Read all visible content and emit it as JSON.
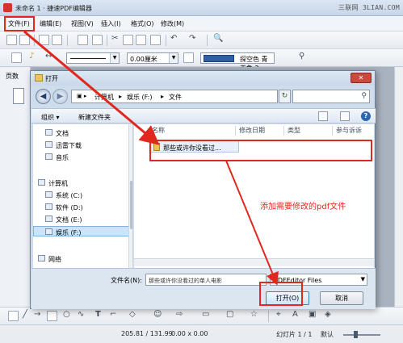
{
  "window": {
    "title": "未命名 1 · 捷速PDF编辑器",
    "watermark": "三联网 3LIAN.COM"
  },
  "menu": {
    "items": [
      "文件(F)",
      "编辑(E)",
      "视图(V)",
      "插入(I)",
      "格式(O)",
      "修改(M)"
    ]
  },
  "toolbar": {
    "line_width_value": "0.00厘米",
    "color_value": "探空色 青天色 2"
  },
  "sidebar": {
    "label": "页数"
  },
  "dialog": {
    "title": "打开",
    "close_label": "✕",
    "address": {
      "crumbs": [
        "计算机",
        "娱乐 (F:)",
        "文件"
      ]
    },
    "commands": {
      "organize": "组织 ▾",
      "new_folder": "新建文件夹"
    },
    "nav_items": [
      {
        "label": "文档",
        "icon": "document-icon"
      },
      {
        "label": "迅雷下载",
        "icon": "download-icon"
      },
      {
        "label": "音乐",
        "icon": "music-icon"
      },
      {
        "label": "计算机",
        "icon": "computer-icon"
      },
      {
        "label": "系统 (C:)",
        "icon": "drive-icon"
      },
      {
        "label": "软件 (D:)",
        "icon": "drive-icon"
      },
      {
        "label": "文档 (E:)",
        "icon": "drive-icon"
      },
      {
        "label": "娱乐 (F:)",
        "icon": "drive-icon"
      },
      {
        "label": "网络",
        "icon": "network-icon"
      }
    ],
    "columns": [
      "名称",
      "修改日期",
      "类型",
      "参与诉诉"
    ],
    "files": [
      {
        "name": "那些或许你没看过..."
      }
    ],
    "filename_label": "文件名(N):",
    "filename_value": "那些或许你没看过的单人电影",
    "filetype_value": "PDFEditor Files",
    "open_label": "打开(O)",
    "cancel_label": "取消"
  },
  "statusbar": {
    "coords": "205.81 / 131.99",
    "size": "0.00 x 0.00",
    "slide": "幻灯片 1 / 1",
    "layout": "默认"
  },
  "annotation": {
    "text": "添加需要修改的pdf文件",
    "color": "#e0281e"
  }
}
